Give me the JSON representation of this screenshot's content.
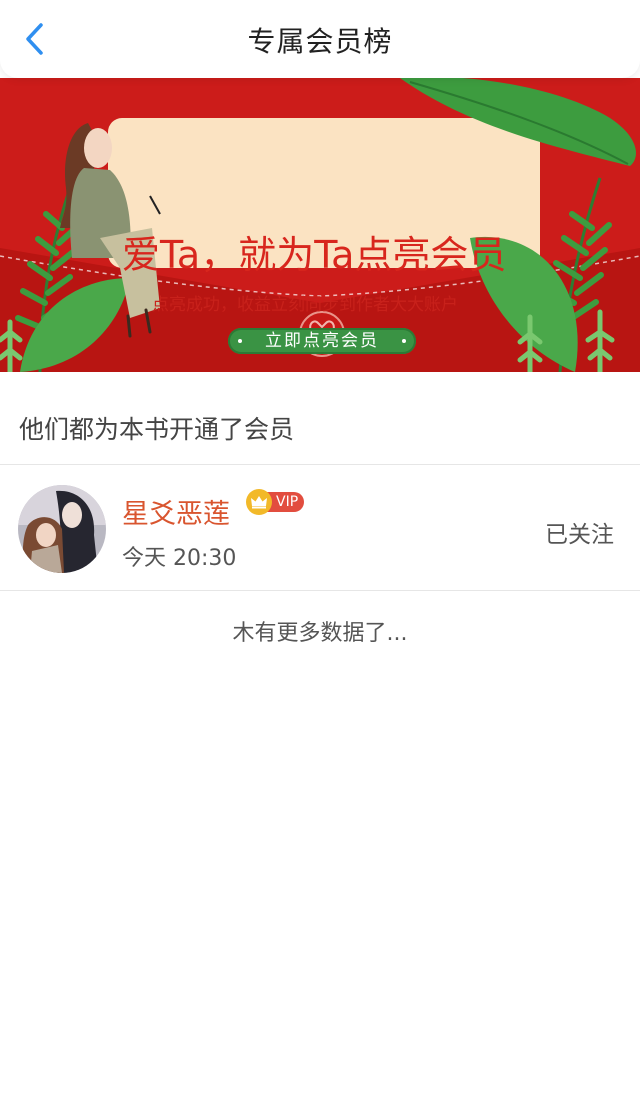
{
  "header": {
    "back_icon": "chevron-left-icon",
    "title": "专属会员榜"
  },
  "banner": {
    "headline": "爱Ta，就为Ta点亮会员",
    "subline": "点亮成功，收益立刻同步到作者大大账户",
    "cta_label": "立即点亮会员",
    "colors": {
      "background": "#cc1c1a",
      "card": "#fbe3c2",
      "cta": "#3a9344",
      "leaf": "#3d9c3f"
    }
  },
  "section": {
    "title": "他们都为本书开通了会员"
  },
  "members": [
    {
      "name": "星爻恶莲",
      "badge": "VIP",
      "time": "今天 20:30",
      "follow_status": "已关注",
      "avatar_icon": "avatar-image"
    }
  ],
  "footer": {
    "no_more_text": "木有更多数据了..."
  },
  "colors": {
    "accent_blue": "#2f8ff0",
    "name_color": "#d9552f",
    "vip_gold": "#f2b929",
    "vip_red": "#e24d3f"
  }
}
